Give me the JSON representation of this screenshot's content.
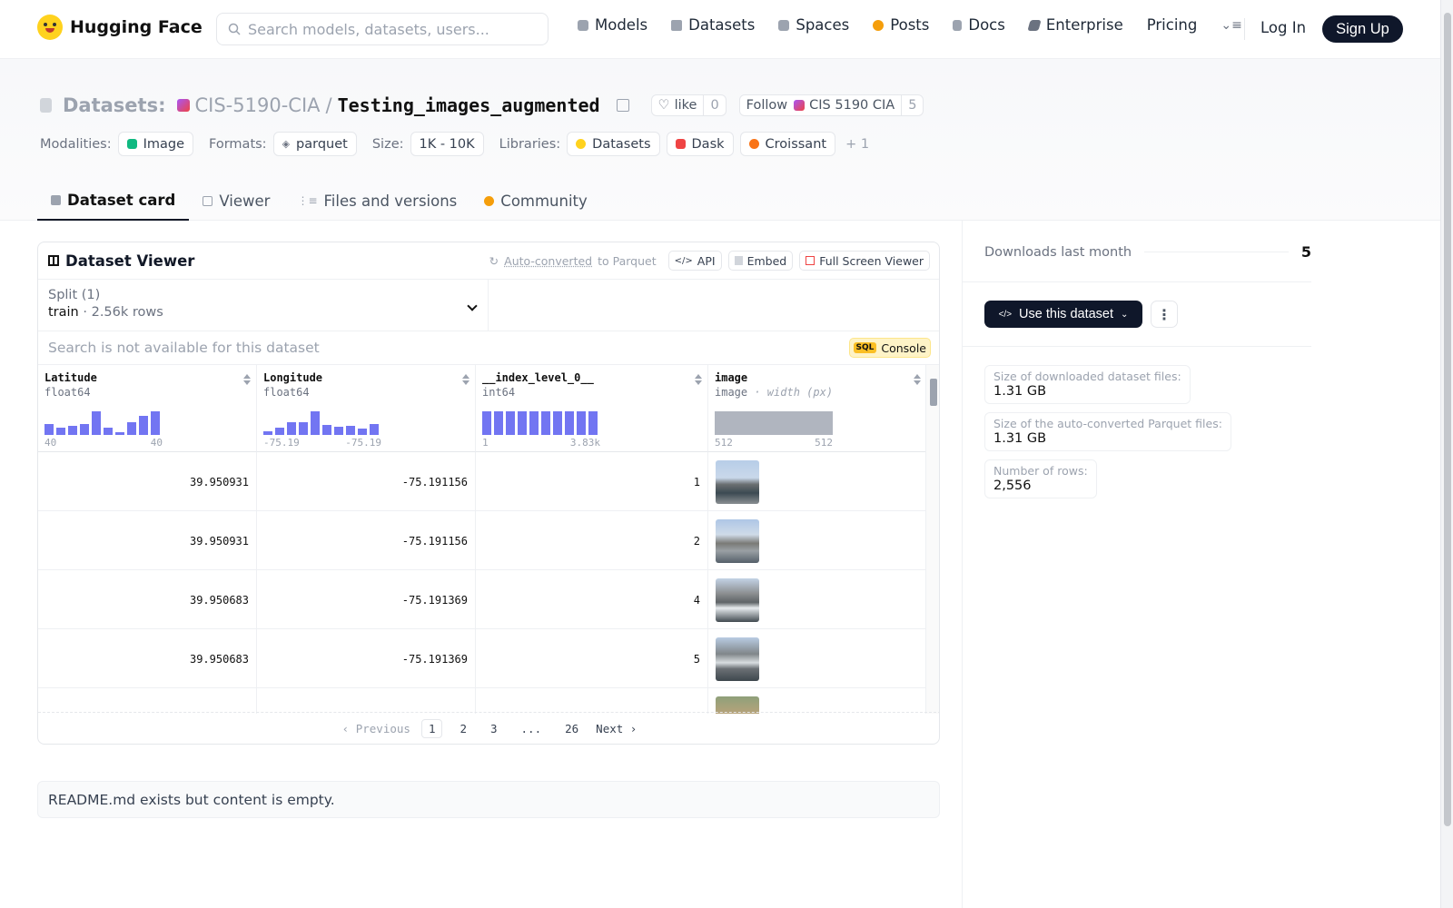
{
  "brand": {
    "name": "Hugging Face"
  },
  "search": {
    "placeholder": "Search models, datasets, users..."
  },
  "nav": {
    "items": [
      {
        "label": "Models",
        "icon": "cube-icon",
        "color": "#9ca3af"
      },
      {
        "label": "Datasets",
        "icon": "database-icon",
        "color": "#9ca3af"
      },
      {
        "label": "Spaces",
        "icon": "grid-icon",
        "color": "#9ca3af"
      },
      {
        "label": "Posts",
        "icon": "posts-icon",
        "color": "#f59e0b"
      },
      {
        "label": "Docs",
        "icon": "docs-icon",
        "color": "#9ca3af"
      },
      {
        "label": "Enterprise",
        "icon": "enterprise-icon",
        "color": "#6b7280"
      },
      {
        "label": "Pricing",
        "icon": "",
        "color": ""
      }
    ],
    "login": "Log In",
    "signup": "Sign Up"
  },
  "header": {
    "section": "Datasets:",
    "org": "CIS-5190-CIA",
    "slash": "/",
    "name": "Testing_images_augmented",
    "like_label": "like",
    "like_count": "0",
    "follow_label": "Follow",
    "follow_org": "CIS 5190 CIA",
    "follow_count": "5"
  },
  "meta": {
    "modalities_label": "Modalities:",
    "modality": "Image",
    "formats_label": "Formats:",
    "format": "parquet",
    "size_label": "Size:",
    "size": "1K - 10K",
    "libraries_label": "Libraries:",
    "libraries": [
      "Datasets",
      "Dask",
      "Croissant"
    ],
    "more": "+ 1"
  },
  "tabs": [
    {
      "label": "Dataset card",
      "active": true
    },
    {
      "label": "Viewer",
      "active": false
    },
    {
      "label": "Files and versions",
      "active": false
    },
    {
      "label": "Community",
      "active": false
    }
  ],
  "viewer": {
    "title": "Dataset Viewer",
    "auto_converted": "Auto-converted",
    "to_parquet": "to Parquet",
    "api": "API",
    "embed": "Embed",
    "fullscreen": "Full Screen Viewer",
    "split_label": "Split (1)",
    "split_name": "train",
    "split_rows": "· 2.56k rows",
    "search_disabled": "Search is not available for this dataset",
    "sql_badge": "SQL",
    "sql_console": "Console",
    "columns": [
      {
        "name": "Latitude",
        "type": "float64",
        "range_min": "40",
        "range_max": "40",
        "hist": [
          0.45,
          0.3,
          0.38,
          0.45,
          1.0,
          0.3,
          0.12,
          0.55,
          0.8,
          1.0
        ]
      },
      {
        "name": "Longitude",
        "type": "float64",
        "range_min": "-75.19",
        "range_max": "-75.19",
        "hist": [
          0.15,
          0.32,
          0.55,
          0.55,
          1.0,
          0.42,
          0.36,
          0.4,
          0.28,
          0.45
        ]
      },
      {
        "name": "__index_level_0__",
        "type": "int64",
        "range_min": "1",
        "range_max": "3.83k",
        "hist": [
          1,
          1,
          1,
          1,
          1,
          1,
          1,
          1,
          1,
          1
        ]
      },
      {
        "name": "image",
        "type": "image",
        "type_extra": "· width (px)",
        "range_min": "512",
        "range_max": "512",
        "hist": [
          1
        ]
      }
    ],
    "rows": [
      {
        "lat": "39.950931",
        "lon": "-75.191156",
        "idx": "1"
      },
      {
        "lat": "39.950931",
        "lon": "-75.191156",
        "idx": "2"
      },
      {
        "lat": "39.950683",
        "lon": "-75.191369",
        "idx": "4"
      },
      {
        "lat": "39.950683",
        "lon": "-75.191369",
        "idx": "5"
      },
      {
        "lat": "",
        "lon": "",
        "idx": ""
      }
    ],
    "pager": {
      "prev": "Previous",
      "pages": [
        "1",
        "2",
        "3",
        "...",
        "26"
      ],
      "next": "Next",
      "current": "1"
    }
  },
  "readme": "README.md exists but content is empty.",
  "sidebar": {
    "downloads_label": "Downloads last month",
    "downloads_value": "5",
    "use_button": "Use this dataset",
    "more_button": "⋮",
    "stats": [
      {
        "label": "Size of downloaded dataset files:",
        "value": "1.31 GB"
      },
      {
        "label": "Size of the auto-converted Parquet files:",
        "value": "1.31 GB"
      },
      {
        "label": "Number of rows:",
        "value": "2,556"
      }
    ]
  },
  "colors": {
    "accent_dark": "#0f172a",
    "histogram": "#6366f1"
  }
}
